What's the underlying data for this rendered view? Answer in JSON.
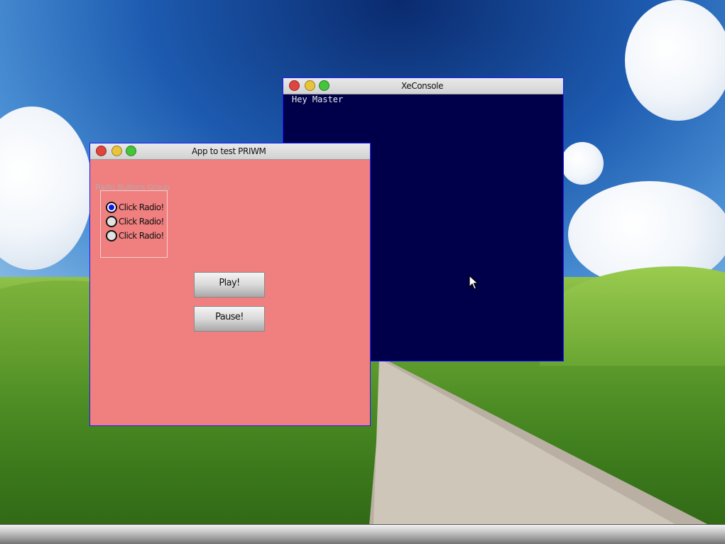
{
  "console_window": {
    "title": "XeConsole",
    "output": "Hey Master"
  },
  "app_window": {
    "title": "App to test PRIWM",
    "radio_group": {
      "label": "Radio Buttons Group",
      "options": [
        {
          "label": "Click Radio!",
          "checked": true
        },
        {
          "label": "Click Radio!",
          "checked": false
        },
        {
          "label": "Click Radio!",
          "checked": false
        }
      ]
    },
    "play_button": "Play!",
    "pause_button": "Pause!"
  },
  "colors": {
    "app_background": "#f07f7f",
    "console_background": "#00004a",
    "window_border": "#1a1aff",
    "close": "#e0443e",
    "minimize": "#e8c43a",
    "maximize": "#44c53a",
    "radio_selected": "#1414e6"
  },
  "icons": [
    "close-icon",
    "minimize-icon",
    "maximize-icon",
    "mouse-pointer-icon"
  ]
}
